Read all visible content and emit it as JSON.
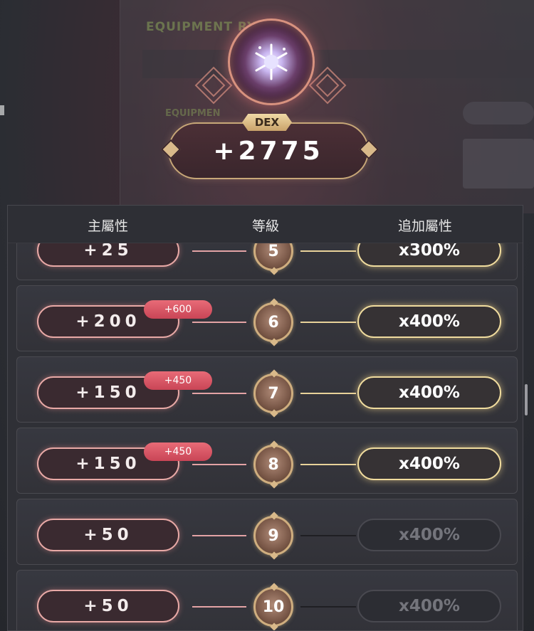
{
  "background": {
    "window_title": "EQUIPMENT     RY",
    "sub_label": "EQUIPMEN"
  },
  "header": {
    "stat_name": "DEX",
    "stat_value": "+2775",
    "icon": "snowflake-gem-icon"
  },
  "table": {
    "col_main": "主屬性",
    "col_level": "等級",
    "col_bonus": "追加屬性",
    "rows": [
      {
        "main": "+25",
        "bonus_badge": "",
        "level": "5",
        "multiplier": "x300%",
        "active": true
      },
      {
        "main": "+200",
        "bonus_badge": "+600",
        "level": "6",
        "multiplier": "x400%",
        "active": true
      },
      {
        "main": "+150",
        "bonus_badge": "+450",
        "level": "7",
        "multiplier": "x400%",
        "active": true
      },
      {
        "main": "+150",
        "bonus_badge": "+450",
        "level": "8",
        "multiplier": "x400%",
        "active": true
      },
      {
        "main": "+50",
        "bonus_badge": "",
        "level": "9",
        "multiplier": "x400%",
        "active": false
      },
      {
        "main": "+50",
        "bonus_badge": "",
        "level": "10",
        "multiplier": "x400%",
        "active": false
      }
    ]
  },
  "colors": {
    "accent_pink": "#e8a9a6",
    "accent_gold": "#f0dc9e",
    "badge": "#e86b77"
  }
}
